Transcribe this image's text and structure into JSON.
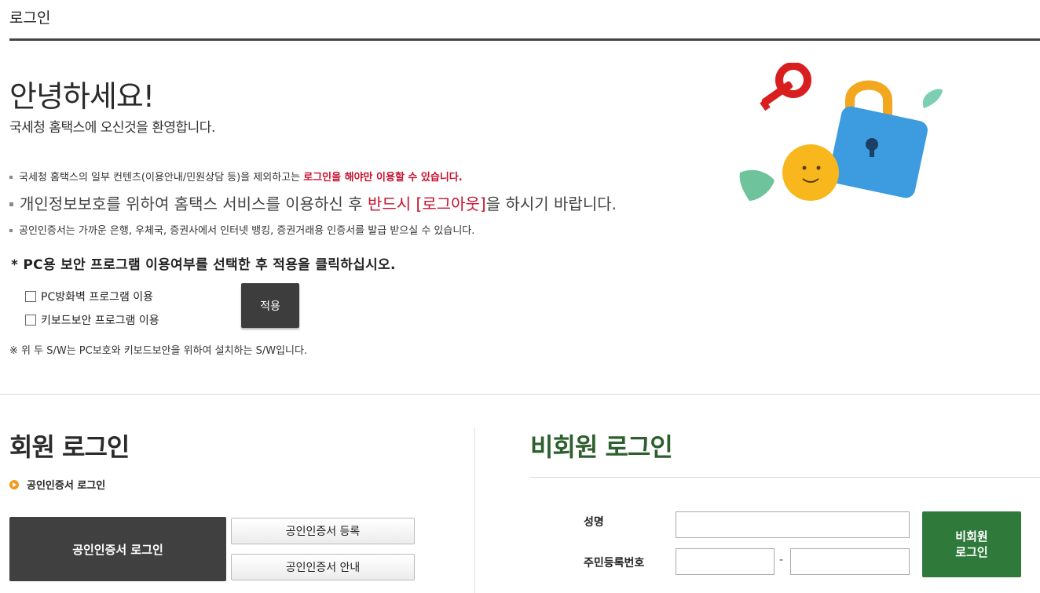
{
  "header": {
    "title": "로그인"
  },
  "welcome": {
    "heading": "안녕하세요!",
    "subheading": "국세청 홈택스에 오신것을 환영합니다."
  },
  "notices": {
    "line1_prefix": "국세청 홈택스의 일부 컨텐츠(이용안내/민원상담 등)을 제외하고는 ",
    "line1_strong": "로그인을 해야만 이용할 수 있습니다.",
    "line2_prefix": "개인정보보호를 위하여 홈택스 서비스를 이용하신 후 ",
    "line2_strong": "반드시 [로그아웃]",
    "line2_suffix": "을 하시기 바랍니다.",
    "line3": "공인인증서는 가까운 은행, 우체국, 증권사에서 인터넷 뱅킹, 증권거래용 인증서를 발급 받으실 수 있습니다."
  },
  "security": {
    "instruction": "* PC용 보안 프로그램 이용여부를 선택한 후 적용을 클릭하십시오.",
    "options": [
      {
        "label": "PC방화벽 프로그램 이용",
        "checked": false
      },
      {
        "label": "키보드보안 프로그램 이용",
        "checked": false
      }
    ],
    "apply_label": "적용",
    "note": "※ 위 두 S/W는 PC보호와 키보드보안을 위하여 설치하는 S/W입니다."
  },
  "member_login": {
    "heading": "회원 로그인",
    "cert_section_label": "공인인증서 로그인",
    "cert_login_button": "공인인증서 로그인",
    "cert_register_button": "공인인증서 등록",
    "cert_info_button": "공인인증서 안내"
  },
  "guest_login": {
    "heading": "비회원 로그인",
    "name_label": "성명",
    "name_value": "",
    "rrn_label": "주민등록번호",
    "rrn_front_value": "",
    "rrn_back_value": "",
    "rrn_separator": "-",
    "login_button": "비회원\n로그인"
  },
  "colors": {
    "accent_red": "#c8102e",
    "guest_green": "#2f7a3b",
    "dark_button": "#404040",
    "bullet_orange": "#f39a1e"
  }
}
